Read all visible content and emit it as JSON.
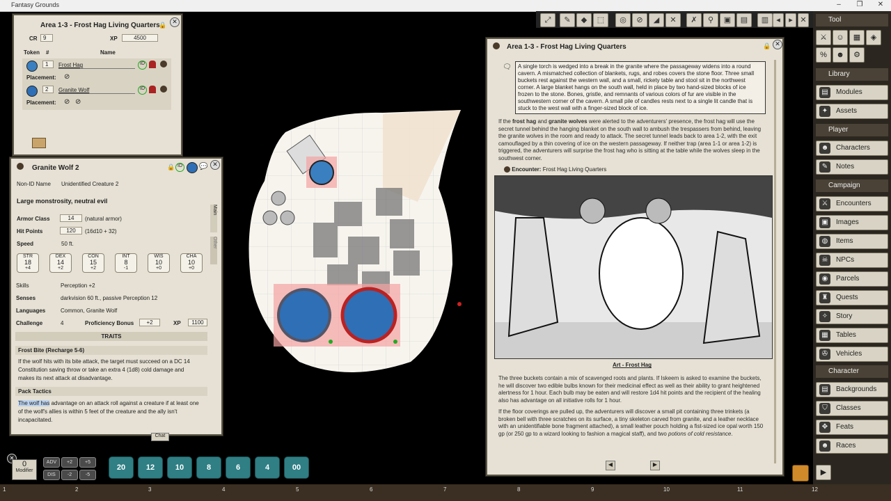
{
  "app": {
    "title": "Fantasy Grounds",
    "min": "–",
    "max": "❐",
    "close": "✕"
  },
  "toolbar": {
    "icons": [
      "expand-icon",
      "pencil-icon",
      "eraser-icon",
      "select-icon",
      "target-icon",
      "no-vision-icon",
      "mask-icon",
      "crossed-swords-icon",
      "pin-icon",
      "lock-icon",
      "unlock-icon",
      "shield-lock-icon"
    ]
  },
  "encounter": {
    "title": "Area 1-3 - Frost Hag Living Quarters",
    "cr_label": "CR",
    "cr": "9",
    "xp_label": "XP",
    "xp": "4500",
    "col_token": "Token",
    "col_num": "#",
    "col_name": "Name",
    "rows": [
      {
        "count": "1",
        "name": "Frost Hag",
        "placement_label": "Placement:"
      },
      {
        "count": "2",
        "name": "Granite Wolf",
        "placement_label": "Placement:"
      }
    ]
  },
  "npc": {
    "title": "Granite Wolf 2",
    "nonid_label": "Non-ID Name",
    "nonid": "Unidentified Creature 2",
    "type": "Large monstrosity, neutral evil",
    "ac_label": "Armor Class",
    "ac": "14",
    "ac_note": "(natural armor)",
    "hp_label": "Hit Points",
    "hp": "120",
    "hp_note": "(16d10 + 32)",
    "speed_label": "Speed",
    "speed": "50 ft.",
    "abilities": [
      {
        "name": "STR",
        "score": "18",
        "mod": "+4"
      },
      {
        "name": "DEX",
        "score": "14",
        "mod": "+2"
      },
      {
        "name": "CON",
        "score": "15",
        "mod": "+2"
      },
      {
        "name": "INT",
        "score": "8",
        "mod": "-1"
      },
      {
        "name": "WIS",
        "score": "10",
        "mod": "+0"
      },
      {
        "name": "CHA",
        "score": "10",
        "mod": "+0"
      }
    ],
    "skills_label": "Skills",
    "skills": "Perception +2",
    "senses_label": "Senses",
    "senses": "darkvision 60 ft., passive Perception 12",
    "languages_label": "Languages",
    "languages": "Common, Granite Wolf",
    "challenge_label": "Challenge",
    "challenge": "4",
    "prof_label": "Proficiency Bonus",
    "prof": "+2",
    "xp_label": "XP",
    "xp": "1100",
    "traits_header": "TRAITS",
    "trait1_name": "Frost Bite (Recharge 5-6)",
    "trait1_text": "If the wolf hits with its bite attack, the target must succeed on a DC 14 Constitution saving throw or take an extra 4 (1d8) cold damage and makes its next attack at disadvantage.",
    "trait2_name": "Pack Tactics",
    "trait2_hl": "The wolf has",
    "trait2_text": " advantage on an attack roll against a creature if at least one of the wolf's allies is within 5 feet of the creature and the ally isn't incapacitated.",
    "tab_main": "Main",
    "tab_other": "Other",
    "chat": "Chat"
  },
  "story": {
    "title": "Area 1-3 - Frost Hag Living Quarters",
    "readaloud": "A single torch is wedged into a break in the granite where the passageway widens into a round cavern. A mismatched collection of blankets, rugs, and robes covers the stone floor. Three small buckets rest against the western wall, and a small, rickety table and stool sit in the northwest corner. A large blanket hangs on the south wall, held in place by two hand-sized blocks of ice frozen to the stone. Bones, gristle, and remnants of various colors of fur are visible in the southwestern corner of the cavern. A small pile of candles rests next to a single lit candle that is stuck to the west wall with a finger-sized block of ice.",
    "p1_a": "If the ",
    "p1_b1": "frost hag",
    "p1_c": " and ",
    "p1_b2": "granite wolves",
    "p1_d": " were alerted to the adventurers' presence, the frost hag will use the secret tunnel behind the hanging blanket on the south wall to ambush the trespassers from behind, leaving the granite wolves in the room and ready to attack. The secret tunnel leads back to area 1-2, with the exit camouflaged by a thin covering of ice on the western passageway. If neither trap (area 1-1 or area 1-2) is triggered, the adventurers will surprise the frost hag who is sitting at the table while the wolves sleep in the southwest corner.",
    "encounter_label": "Encounter:",
    "encounter_link": "Frost Hag Living Quarters",
    "art_caption": "Art - Frost Hag",
    "p2": "The three buckets contain a mix of scavenged roots and plants. If Iskeem is asked to examine the buckets, he will discover two edible bulbs known for their medicinal effect as well as their ability to grant heightened alertness for 1 hour. Each bulb may be eaten and will restore 1d4 hit points and the recipient of the healing also has advantage on all initiative rolls for 1 hour.",
    "p3_a": "If the floor coverings are pulled up, the adventurers will discover a small pit containing three trinkets (a broken bell with three scratches on its surface, a tiny skeleton carved from granite, and a leather necklace with an unidentifiable bone fragment attached), a small leather pouch holding a fist-sized ice opal worth 150 gp (or 250 gp to a wizard looking to fashion a magical staff), and two ",
    "p3_i": "potions of cold resistance",
    "p3_b": "."
  },
  "sidebar": {
    "tool": "Tool",
    "library": "Library",
    "modules": "Modules",
    "assets": "Assets",
    "player": "Player",
    "characters": "Characters",
    "notes": "Notes",
    "campaign": "Campaign",
    "encounters": "Encounters",
    "images": "Images",
    "items": "Items",
    "npcs": "NPCs",
    "parcels": "Parcels",
    "quests": "Quests",
    "story": "Story",
    "tables": "Tables",
    "vehicles": "Vehicles",
    "character": "Character",
    "backgrounds": "Backgrounds",
    "classes": "Classes",
    "feats": "Feats",
    "races": "Races"
  },
  "bottom": {
    "modifier_value": "0",
    "modifier_label": "Modifier",
    "adv": "ADV",
    "dis": "DIS",
    "p2": "+2",
    "p5": "+5",
    "m2": "-2",
    "m5": "-5",
    "dice": [
      "20",
      "12",
      "10",
      "8",
      "6",
      "4",
      "00"
    ],
    "ruler": [
      "1",
      "2",
      "3",
      "4",
      "5",
      "6",
      "7",
      "8",
      "9",
      "10",
      "11",
      "12"
    ]
  }
}
